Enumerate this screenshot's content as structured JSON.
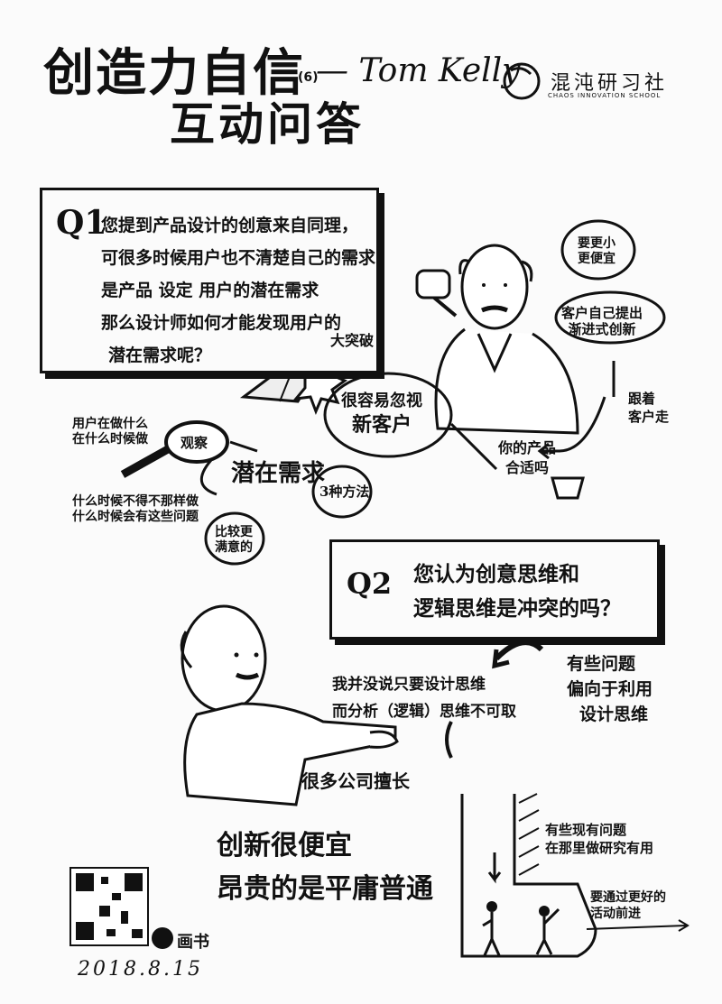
{
  "title": {
    "line1": "创造力自信",
    "of": "(6)",
    "author": "— Tom Kelly",
    "line2": "互动问答"
  },
  "brand": {
    "name": "混沌研习社",
    "tagline": "CHAOS INNOVATION SCHOOL"
  },
  "q1": {
    "label": "Q1",
    "lines": [
      "您提到产品设计的创意来自同理，",
      "可很多时候用户也不清楚自己的需求",
      "是产品 设定 用户的潜在需求",
      "那么设计师如何才能发现用户的",
      "潜在需求呢？"
    ]
  },
  "bubbles": {
    "top_right": [
      "要更小",
      "更便宜"
    ],
    "customer": [
      "客户自己提出",
      "渐进式创新"
    ],
    "follow": [
      "跟着",
      "客户走"
    ],
    "breakthrough": "大突破",
    "ignore_client": [
      "很容易忽视",
      "新客户"
    ],
    "your_product": [
      "你的产品",
      "合适吗"
    ],
    "observe": "观察",
    "what_doing": [
      "用户在做什么",
      "在什么时候做"
    ],
    "why": [
      "什么时候不得不那样做",
      "什么时候会有这些问题"
    ],
    "latent": "潜在需求",
    "three_steps": "3种方法",
    "compare": [
      "比较更",
      "满意的"
    ]
  },
  "q2": {
    "label": "Q2",
    "lines": [
      "您认为创意思维和",
      "逻辑思维是冲突的吗？"
    ]
  },
  "q2_notes": {
    "some_problems": [
      "有些问题",
      "偏向于利用",
      "设计思维"
    ],
    "quote": [
      "我并没说只要设计思维",
      "而分析（逻辑）思维不可取"
    ],
    "good_at": "很多公司擅长"
  },
  "footer": {
    "slogan1": "创新很便宜",
    "slogan2": "昂贵的是平庸普通",
    "pit_note": [
      "有些现有问题",
      "在那里做研究有用"
    ],
    "move_note": [
      "要通过更好的",
      "活动前进"
    ],
    "signature": "画书",
    "date": "2018.8.15"
  }
}
